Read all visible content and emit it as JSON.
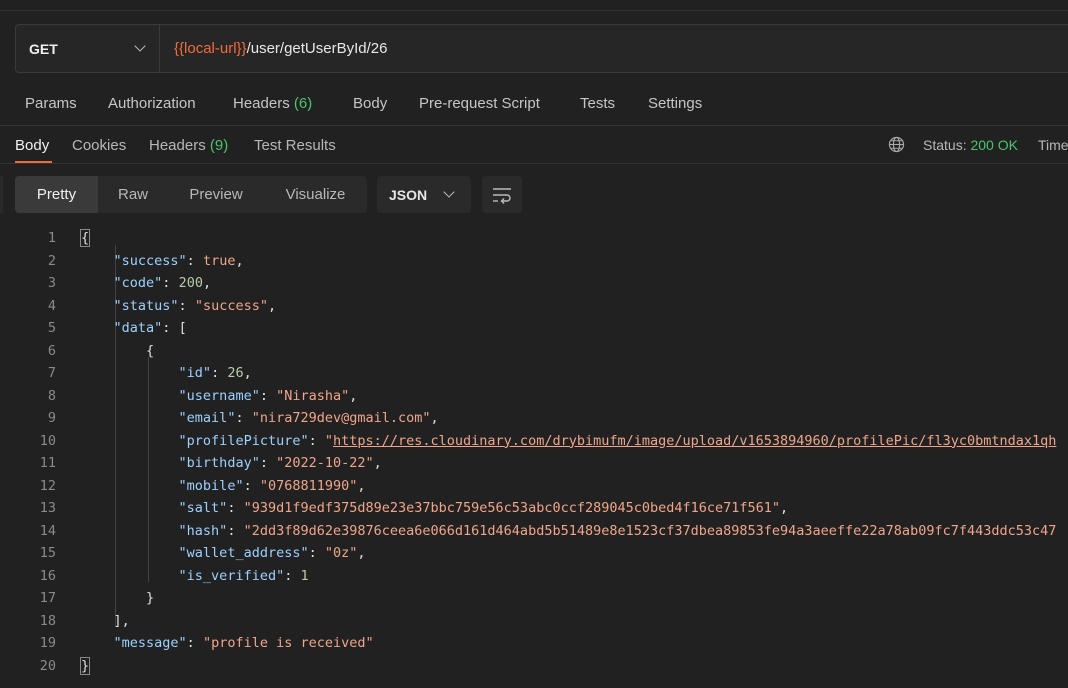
{
  "request": {
    "method": "GET",
    "url_variable": "{{local-url}}",
    "url_path": "/user/getUserById/26"
  },
  "request_tabs": [
    {
      "label": "Params"
    },
    {
      "label": "Authorization"
    },
    {
      "label": "Headers",
      "count": "(6)"
    },
    {
      "label": "Body"
    },
    {
      "label": "Pre-request Script"
    },
    {
      "label": "Tests"
    },
    {
      "label": "Settings"
    }
  ],
  "response_tabs": [
    {
      "label": "Body",
      "active": true
    },
    {
      "label": "Cookies"
    },
    {
      "label": "Headers",
      "count": "(9)"
    },
    {
      "label": "Test Results"
    }
  ],
  "status": {
    "label": "Status:",
    "value": "200 OK",
    "time_label": "Time"
  },
  "view_modes": [
    "Pretty",
    "Raw",
    "Preview",
    "Visualize"
  ],
  "active_view": "Pretty",
  "format": "JSON",
  "icons": {
    "globe": "globe-icon",
    "wrap": "wrap-lines-icon",
    "format_dropdown": "chevron-down-icon",
    "method_dropdown": "chevron-down-icon"
  },
  "colors": {
    "accent": "#f26b3a",
    "success": "#4cc46c"
  },
  "code_lines": [
    {
      "num": "1",
      "text": "{"
    },
    {
      "num": "2",
      "text": "    \"success\": true,"
    },
    {
      "num": "3",
      "text": "    \"code\": 200,"
    },
    {
      "num": "4",
      "text": "    \"status\": \"success\","
    },
    {
      "num": "5",
      "text": "    \"data\": ["
    },
    {
      "num": "6",
      "text": "        {"
    },
    {
      "num": "7",
      "text": "            \"id\": 26,"
    },
    {
      "num": "8",
      "text": "            \"username\": \"Nirasha\","
    },
    {
      "num": "9",
      "text": "            \"email\": \"nira729dev@gmail.com\","
    },
    {
      "num": "10",
      "text": "            \"profilePicture\": \"https://res.cloudinary.com/drybimufm/image/upload/v1653894960/profilePic/fl3yc0bmtndax1qh"
    },
    {
      "num": "11",
      "text": "            \"birthday\": \"2022-10-22\","
    },
    {
      "num": "12",
      "text": "            \"mobile\": \"0768811990\","
    },
    {
      "num": "13",
      "text": "            \"salt\": \"939d1f9edf375d89e23e37bbc759e56c53abc0ccf289045c0bed4f16ce71f561\","
    },
    {
      "num": "14",
      "text": "            \"hash\": \"2dd3f89d62e39876ceea6e066d161d464abd5b51489e8e1523cf37dbea89853fe94a3aeeffe22a78ab09fc7f443ddc53c47"
    },
    {
      "num": "15",
      "text": "            \"wallet_address\": \"0z\","
    },
    {
      "num": "16",
      "text": "            \"is_verified\": 1"
    },
    {
      "num": "17",
      "text": "        }"
    },
    {
      "num": "18",
      "text": "    ],"
    },
    {
      "num": "19",
      "text": "    \"message\": \"profile is received\""
    },
    {
      "num": "20",
      "text": "}"
    }
  ]
}
